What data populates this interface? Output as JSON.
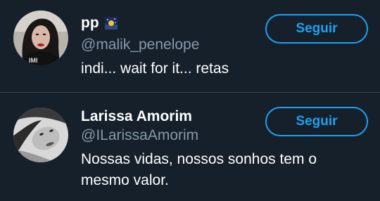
{
  "colors": {
    "background": "#15202b",
    "divider": "#38444d",
    "accent": "#1da1f2",
    "secondary_text": "#8899a6",
    "primary_text": "#ffffff"
  },
  "users": [
    {
      "display_name": "pp",
      "name_emoji": "night-sky-emoji-icon",
      "handle": "@malik_penelope",
      "bio": "indi... wait for it... retas",
      "follow_label": "Seguir",
      "avatar": "avatar-dark-hair-red-lips"
    },
    {
      "display_name": "Larissa Amorim",
      "handle": "@ILarissaAmorim",
      "bio": "Nossas vidas, nossos sonhos tem o mesmo valor.",
      "follow_label": "Seguir",
      "avatar": "avatar-grayscale-selfie"
    }
  ]
}
